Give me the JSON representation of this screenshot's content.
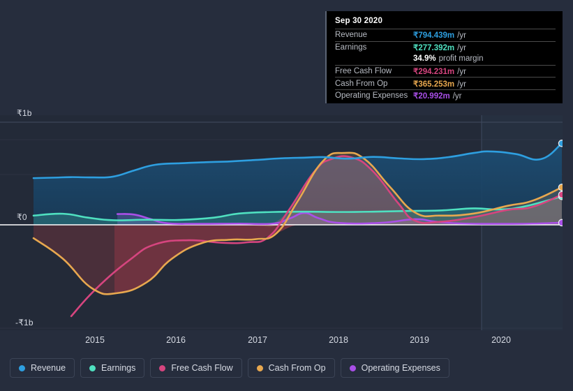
{
  "chart_data": {
    "type": "area",
    "title": "",
    "xlabel": "",
    "ylabel": "",
    "currency": "₹",
    "ylim": [
      -1000000000,
      1000000000
    ],
    "y_ticks": [
      {
        "label": "₹1b",
        "value": 1000000000
      },
      {
        "label": "₹0",
        "value": 0
      },
      {
        "label": "-₹1b",
        "value": -1000000000
      }
    ],
    "x_ticks": [
      "2015",
      "2016",
      "2017",
      "2018",
      "2019",
      "2020"
    ],
    "grid": true,
    "legend_position": "bottom",
    "series": [
      {
        "name": "Revenue",
        "color": "#2e9fe0",
        "points": [
          [
            2014.55,
            0.455
          ],
          [
            2014.8,
            0.46
          ],
          [
            2015.0,
            0.465
          ],
          [
            2015.25,
            0.462
          ],
          [
            2015.5,
            0.47
          ],
          [
            2015.75,
            0.53
          ],
          [
            2016.0,
            0.585
          ],
          [
            2016.3,
            0.6
          ],
          [
            2016.6,
            0.61
          ],
          [
            2016.9,
            0.618
          ],
          [
            2017.2,
            0.632
          ],
          [
            2017.5,
            0.648
          ],
          [
            2017.8,
            0.655
          ],
          [
            2018.0,
            0.66
          ],
          [
            2018.3,
            0.645
          ],
          [
            2018.6,
            0.662
          ],
          [
            2018.9,
            0.648
          ],
          [
            2019.2,
            0.64
          ],
          [
            2019.5,
            0.66
          ],
          [
            2019.8,
            0.7
          ],
          [
            2020.0,
            0.715
          ],
          [
            2020.3,
            0.69
          ],
          [
            2020.6,
            0.64
          ],
          [
            2020.85,
            0.794
          ]
        ]
      },
      {
        "name": "Earnings",
        "color": "#4fe0c0",
        "points": [
          [
            2014.55,
            0.09
          ],
          [
            2014.9,
            0.108
          ],
          [
            2015.2,
            0.07
          ],
          [
            2015.5,
            0.045
          ],
          [
            2015.9,
            0.05
          ],
          [
            2016.3,
            0.048
          ],
          [
            2016.7,
            0.07
          ],
          [
            2017.0,
            0.11
          ],
          [
            2017.4,
            0.125
          ],
          [
            2017.8,
            0.128
          ],
          [
            2018.2,
            0.125
          ],
          [
            2018.6,
            0.128
          ],
          [
            2019.0,
            0.135
          ],
          [
            2019.4,
            0.14
          ],
          [
            2019.8,
            0.16
          ],
          [
            2020.1,
            0.15
          ],
          [
            2020.4,
            0.178
          ],
          [
            2020.85,
            0.277
          ]
        ]
      },
      {
        "name": "Free Cash Flow",
        "color": "#d6457f",
        "points": [
          [
            2015.0,
            -0.89
          ],
          [
            2015.3,
            -0.62
          ],
          [
            2015.7,
            -0.34
          ],
          [
            2016.0,
            -0.19
          ],
          [
            2016.4,
            -0.15
          ],
          [
            2016.8,
            -0.175
          ],
          [
            2017.1,
            -0.17
          ],
          [
            2017.35,
            -0.12
          ],
          [
            2017.6,
            0.15
          ],
          [
            2017.9,
            0.52
          ],
          [
            2018.1,
            0.64
          ],
          [
            2018.35,
            0.655
          ],
          [
            2018.6,
            0.52
          ],
          [
            2018.9,
            0.21
          ],
          [
            2019.1,
            0.04
          ],
          [
            2019.4,
            0.03
          ],
          [
            2019.8,
            0.075
          ],
          [
            2020.2,
            0.145
          ],
          [
            2020.5,
            0.175
          ],
          [
            2020.85,
            0.294
          ]
        ]
      },
      {
        "name": "Cash From Op",
        "color": "#e8a84f",
        "points": [
          [
            2014.55,
            -0.13
          ],
          [
            2014.9,
            -0.33
          ],
          [
            2015.25,
            -0.62
          ],
          [
            2015.55,
            -0.665
          ],
          [
            2015.9,
            -0.56
          ],
          [
            2016.2,
            -0.33
          ],
          [
            2016.55,
            -0.18
          ],
          [
            2016.9,
            -0.145
          ],
          [
            2017.2,
            -0.14
          ],
          [
            2017.45,
            -0.08
          ],
          [
            2017.7,
            0.23
          ],
          [
            2018.0,
            0.62
          ],
          [
            2018.25,
            0.7
          ],
          [
            2018.5,
            0.64
          ],
          [
            2018.8,
            0.37
          ],
          [
            2019.1,
            0.12
          ],
          [
            2019.4,
            0.09
          ],
          [
            2019.8,
            0.11
          ],
          [
            2020.2,
            0.185
          ],
          [
            2020.5,
            0.235
          ],
          [
            2020.85,
            0.365
          ]
        ]
      },
      {
        "name": "Operating Expenses",
        "color": "#a94fe8",
        "points": [
          [
            2015.55,
            0.105
          ],
          [
            2015.75,
            0.1
          ],
          [
            2015.95,
            0.055
          ],
          [
            2016.15,
            0.015
          ],
          [
            2016.5,
            0.01
          ],
          [
            2017.0,
            0.012
          ],
          [
            2017.4,
            0.012
          ],
          [
            2017.6,
            0.06
          ],
          [
            2017.78,
            0.115
          ],
          [
            2017.95,
            0.065
          ],
          [
            2018.2,
            0.018
          ],
          [
            2018.7,
            0.02
          ],
          [
            2019.1,
            0.055
          ],
          [
            2019.35,
            0.03
          ],
          [
            2019.7,
            0.012
          ],
          [
            2020.2,
            0.01
          ],
          [
            2020.5,
            0.012
          ],
          [
            2020.85,
            0.021
          ]
        ]
      }
    ]
  },
  "tooltip": {
    "date": "Sep 30 2020",
    "rows": [
      {
        "name": "Revenue",
        "value": "₹794.439m",
        "unit": "/yr",
        "color": "#2e9fe0"
      },
      {
        "name": "Earnings",
        "value": "₹277.392m",
        "unit": "/yr",
        "color": "#4fe0c0"
      },
      {
        "name": "",
        "value": "34.9%",
        "unit": "profit margin",
        "color": "#ffffff",
        "is_margin": true
      },
      {
        "name": "Free Cash Flow",
        "value": "₹294.231m",
        "unit": "/yr",
        "color": "#d6457f"
      },
      {
        "name": "Cash From Op",
        "value": "₹365.253m",
        "unit": "/yr",
        "color": "#e8a84f"
      },
      {
        "name": "Operating Expenses",
        "value": "₹20.992m",
        "unit": "/yr",
        "color": "#a94fe8"
      }
    ]
  },
  "legend": {
    "items": [
      {
        "label": "Revenue",
        "color": "#2e9fe0"
      },
      {
        "label": "Earnings",
        "color": "#4fe0c0"
      },
      {
        "label": "Free Cash Flow",
        "color": "#d6457f"
      },
      {
        "label": "Cash From Op",
        "color": "#e8a84f"
      },
      {
        "label": "Operating Expenses",
        "color": "#a94fe8"
      }
    ]
  },
  "axis": {
    "y_labels": [
      "₹1b",
      "₹0",
      "-₹1b"
    ],
    "x_labels": [
      "2015",
      "2016",
      "2017",
      "2018",
      "2019",
      "2020"
    ]
  }
}
